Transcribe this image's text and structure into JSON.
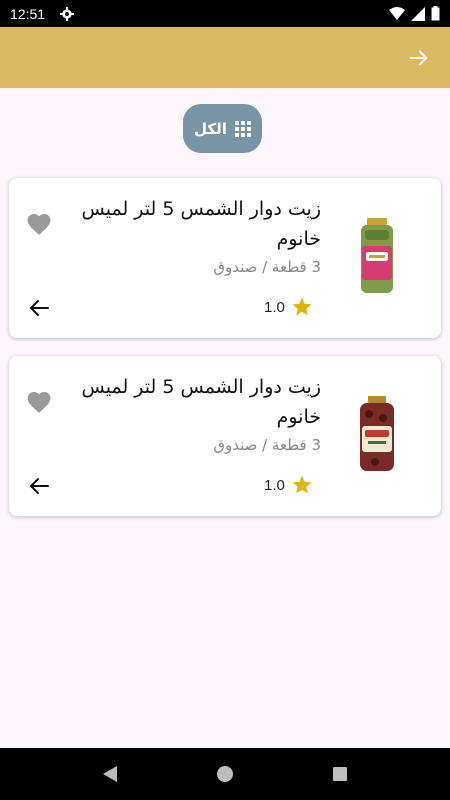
{
  "status_bar": {
    "time": "12:51"
  },
  "filter_chip": {
    "label": "الكل"
  },
  "products": [
    {
      "title": "زيت دوار الشمس 5 لتر لميس خانوم",
      "subtitle": "3 قطعة / صندوق",
      "rating": "1.0"
    },
    {
      "title": "زيت دوار الشمس 5 لتر لميس خانوم",
      "subtitle": "3 قطعة / صندوق",
      "rating": "1.0"
    }
  ],
  "colors": {
    "app_bar": "#dbb963",
    "chip": "#7a94a7",
    "star": "#e2b30f",
    "background": "#fdf7fd"
  }
}
